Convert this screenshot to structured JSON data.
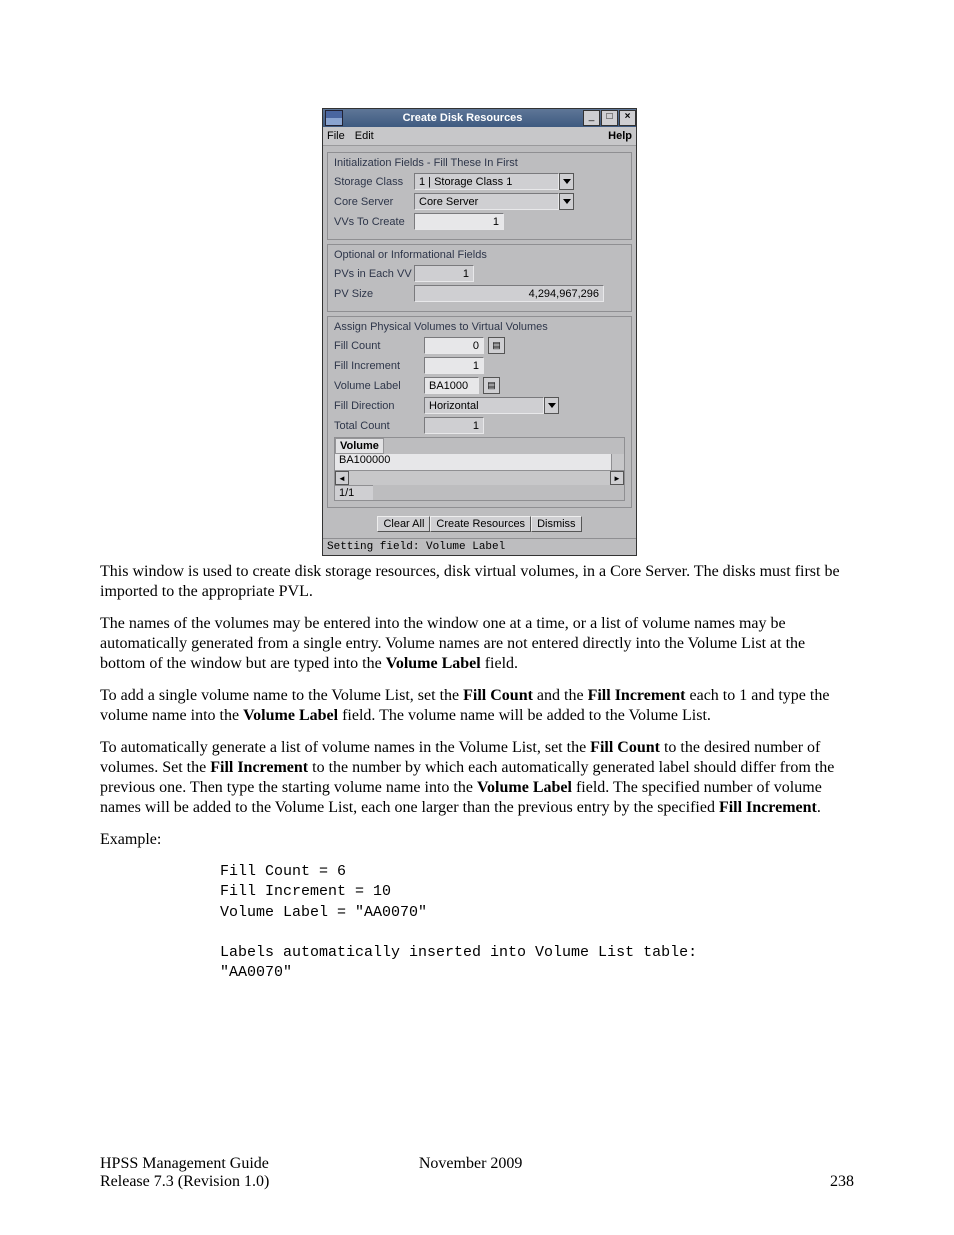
{
  "dialog": {
    "title": "Create Disk Resources",
    "menubar": {
      "file": "File",
      "edit": "Edit",
      "help": "Help"
    },
    "group1": {
      "title": "Initialization Fields - Fill These In First",
      "storage_class_label": "Storage Class",
      "storage_class_value": "1 | Storage Class 1",
      "core_server_label": "Core Server",
      "core_server_value": "Core Server",
      "vvs_label": "VVs To Create",
      "vvs_value": "1"
    },
    "group2": {
      "title": "Optional or Informational Fields",
      "pvs_label": "PVs in Each VV",
      "pvs_value": "1",
      "pvsize_label": "PV Size",
      "pvsize_value": "4,294,967,296"
    },
    "group3": {
      "title": "Assign Physical Volumes to Virtual Volumes",
      "fill_count_label": "Fill Count",
      "fill_count_value": "0",
      "fill_incr_label": "Fill Increment",
      "fill_incr_value": "1",
      "vol_label_label": "Volume Label",
      "vol_label_value": "BA1000",
      "fill_dir_label": "Fill Direction",
      "fill_dir_value": "Horizontal",
      "total_count_label": "Total Count",
      "total_count_value": "1",
      "list_header": "Volume",
      "list_item": "BA100000",
      "list_footer": "1/1"
    },
    "buttons": {
      "clear": "Clear All",
      "create": "Create Resources",
      "dismiss": "Dismiss"
    },
    "status": "Setting field: Volume Label"
  },
  "body": {
    "p1a": "This window is used to create disk storage resources, disk virtual volumes, in a Core Server. The disks must first be imported to the appropriate PVL.",
    "p2a": "The names of the volumes may be entered into the window one at a time, or a list of volume names may be automatically generated from a single entry. Volume names are not entered directly into the Volume List at the bottom of the window but are typed into the ",
    "p2b": "Volume Label",
    "p2c": " field.",
    "p3a": "To add a single volume name to the Volume List, set the ",
    "p3b": "Fill Count",
    "p3c": " and the ",
    "p3d": "Fill Increment",
    "p3e": " each to 1 and type the volume name into the ",
    "p3f": "Volume Label",
    "p3g": " field. The volume name will be added to the Volume List.",
    "p4a": "To automatically generate a list of volume names in the Volume List, set the ",
    "p4b": "Fill Count",
    "p4c": " to the desired number of volumes. Set the ",
    "p4d": "Fill Increment",
    "p4e": " to the number by which each automatically generated label should differ from the previous one. Then type the starting volume name into the ",
    "p4f": "Volume Label",
    "p4g": " field. The specified number of volume names will be added to the Volume List, each one larger than the previous entry by the specified ",
    "p4h": "Fill Increment",
    "p4i": ".",
    "example_label": "Example:",
    "pre1": "Fill Count = 6",
    "pre2": "Fill Increment = 10",
    "pre3": "Volume Label = \"AA0070\"",
    "pre4": "Labels automatically inserted into Volume List table:",
    "pre5": "\"AA0070\""
  },
  "footer": {
    "guide": "HPSS Management Guide",
    "date": "November 2009",
    "release": "Release 7.3 (Revision 1.0)",
    "page": "238"
  }
}
